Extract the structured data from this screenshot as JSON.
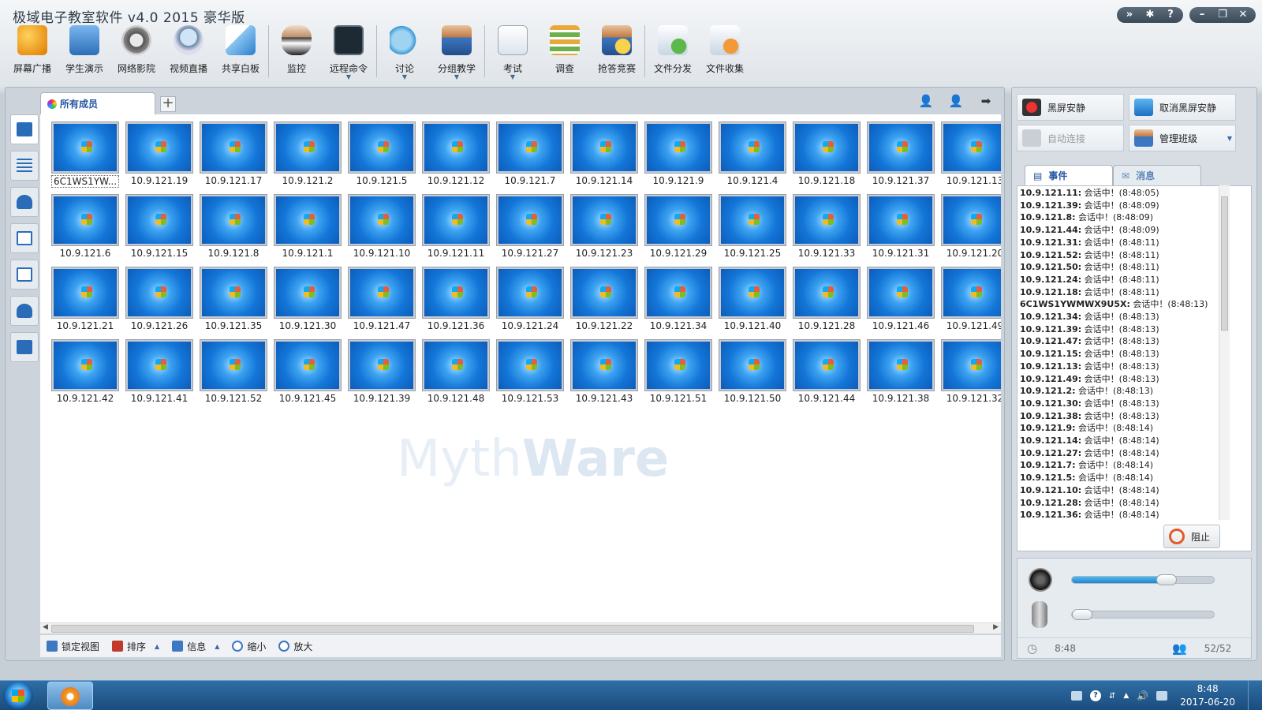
{
  "app": {
    "title": "极域电子教室软件 v4.0 2015 豪华版"
  },
  "window_buttons": [
    "expand-icon",
    "gear-icon",
    "help-icon",
    "minimize-icon",
    "restore-icon",
    "close-icon"
  ],
  "toolbar": [
    {
      "label": "屏幕广播",
      "icon": "broadcast-icon",
      "dropdown": false
    },
    {
      "label": "学生演示",
      "icon": "student-demo-icon",
      "dropdown": false
    },
    {
      "label": "网络影院",
      "icon": "film-reel-icon",
      "dropdown": false
    },
    {
      "label": "视频直播",
      "icon": "webcam-icon",
      "dropdown": false
    },
    {
      "label": "共享白板",
      "icon": "whiteboard-icon",
      "dropdown": false
    },
    {
      "label": "监控",
      "icon": "monitor-person-icon",
      "dropdown": false
    },
    {
      "label": "远程命令",
      "icon": "command-prompt-icon",
      "dropdown": true
    },
    {
      "label": "讨论",
      "icon": "chat-bubbles-icon",
      "dropdown": true
    },
    {
      "label": "分组教学",
      "icon": "group-teaching-icon",
      "dropdown": true
    },
    {
      "label": "考试",
      "icon": "exam-clock-icon",
      "dropdown": true
    },
    {
      "label": "调查",
      "icon": "survey-bars-icon",
      "dropdown": false
    },
    {
      "label": "抢答竞赛",
      "icon": "quiz-star-icon",
      "dropdown": false
    },
    {
      "label": "文件分发",
      "icon": "file-send-icon",
      "dropdown": false
    },
    {
      "label": "文件收集",
      "icon": "file-collect-icon",
      "dropdown": false
    }
  ],
  "tabs": {
    "active": "所有成员",
    "add": "+"
  },
  "watermark": {
    "a": "Myth",
    "b": "Ware"
  },
  "members": [
    {
      "name": "6C1WS1YWMWX9U5X",
      "display": "6C1WS1YW..."
    },
    {
      "name": "10.9.121.19"
    },
    {
      "name": "10.9.121.17"
    },
    {
      "name": "10.9.121.2"
    },
    {
      "name": "10.9.121.5"
    },
    {
      "name": "10.9.121.12"
    },
    {
      "name": "10.9.121.7"
    },
    {
      "name": "10.9.121.14"
    },
    {
      "name": "10.9.121.9"
    },
    {
      "name": "10.9.121.4"
    },
    {
      "name": "10.9.121.18"
    },
    {
      "name": "10.9.121.37"
    },
    {
      "name": "10.9.121.13"
    },
    {
      "name": "10.9.121.6"
    },
    {
      "name": "10.9.121.15"
    },
    {
      "name": "10.9.121.8"
    },
    {
      "name": "10.9.121.1"
    },
    {
      "name": "10.9.121.10"
    },
    {
      "name": "10.9.121.11"
    },
    {
      "name": "10.9.121.27"
    },
    {
      "name": "10.9.121.23"
    },
    {
      "name": "10.9.121.29"
    },
    {
      "name": "10.9.121.25"
    },
    {
      "name": "10.9.121.33"
    },
    {
      "name": "10.9.121.31"
    },
    {
      "name": "10.9.121.20"
    },
    {
      "name": "10.9.121.21"
    },
    {
      "name": "10.9.121.26"
    },
    {
      "name": "10.9.121.35"
    },
    {
      "name": "10.9.121.30"
    },
    {
      "name": "10.9.121.47"
    },
    {
      "name": "10.9.121.36"
    },
    {
      "name": "10.9.121.24"
    },
    {
      "name": "10.9.121.22"
    },
    {
      "name": "10.9.121.34"
    },
    {
      "name": "10.9.121.40"
    },
    {
      "name": "10.9.121.28"
    },
    {
      "name": "10.9.121.46"
    },
    {
      "name": "10.9.121.49"
    },
    {
      "name": "10.9.121.42"
    },
    {
      "name": "10.9.121.41"
    },
    {
      "name": "10.9.121.52"
    },
    {
      "name": "10.9.121.45"
    },
    {
      "name": "10.9.121.39"
    },
    {
      "name": "10.9.121.48"
    },
    {
      "name": "10.9.121.53"
    },
    {
      "name": "10.9.121.43"
    },
    {
      "name": "10.9.121.51"
    },
    {
      "name": "10.9.121.50"
    },
    {
      "name": "10.9.121.44"
    },
    {
      "name": "10.9.121.38"
    },
    {
      "name": "10.9.121.32"
    }
  ],
  "bottom_bar": {
    "lock_view": "锁定视图",
    "sort": "排序",
    "info": "信息",
    "zoom_out": "缩小",
    "zoom_in": "放大"
  },
  "controls": {
    "black_screen": "黑屏安静",
    "cancel_black_screen": "取消黑屏安静",
    "auto_connect": "自动连接",
    "manage_class": "管理班级"
  },
  "event_tabs": {
    "events": "事件",
    "messages": "消息"
  },
  "events": [
    {
      "who": "10.9.121.11:",
      "text": " 会话中！(8:48:05)"
    },
    {
      "who": "10.9.121.39:",
      "text": " 会话中！(8:48:09)"
    },
    {
      "who": "10.9.121.8:",
      "text": " 会话中！(8:48:09)"
    },
    {
      "who": "10.9.121.44:",
      "text": " 会话中！(8:48:09)"
    },
    {
      "who": "10.9.121.31:",
      "text": " 会话中！(8:48:11)"
    },
    {
      "who": "10.9.121.52:",
      "text": " 会话中！(8:48:11)"
    },
    {
      "who": "10.9.121.50:",
      "text": " 会话中！(8:48:11)"
    },
    {
      "who": "10.9.121.24:",
      "text": " 会话中！(8:48:11)"
    },
    {
      "who": "10.9.121.18:",
      "text": " 会话中！(8:48:11)"
    },
    {
      "who": "6C1WS1YWMWX9U5X:",
      "text": " 会话中！(8:48:13)"
    },
    {
      "who": "10.9.121.34:",
      "text": " 会话中！(8:48:13)"
    },
    {
      "who": "10.9.121.39:",
      "text": " 会话中！(8:48:13)"
    },
    {
      "who": "10.9.121.47:",
      "text": " 会话中！(8:48:13)"
    },
    {
      "who": "10.9.121.15:",
      "text": " 会话中！(8:48:13)"
    },
    {
      "who": "10.9.121.13:",
      "text": " 会话中！(8:48:13)"
    },
    {
      "who": "10.9.121.49:",
      "text": " 会话中！(8:48:13)"
    },
    {
      "who": "10.9.121.2:",
      "text": " 会话中！(8:48:13)"
    },
    {
      "who": "10.9.121.30:",
      "text": " 会话中！(8:48:13)"
    },
    {
      "who": "10.9.121.38:",
      "text": " 会话中！(8:48:13)"
    },
    {
      "who": "10.9.121.9:",
      "text": " 会话中！(8:48:14)"
    },
    {
      "who": "10.9.121.14:",
      "text": " 会话中！(8:48:14)"
    },
    {
      "who": "10.9.121.27:",
      "text": " 会话中！(8:48:14)"
    },
    {
      "who": "10.9.121.7:",
      "text": " 会话中！(8:48:14)"
    },
    {
      "who": "10.9.121.5:",
      "text": " 会话中！(8:48:14)"
    },
    {
      "who": "10.9.121.10:",
      "text": " 会话中！(8:48:14)"
    },
    {
      "who": "10.9.121.28:",
      "text": " 会话中！(8:48:14)"
    },
    {
      "who": "10.9.121.36:",
      "text": " 会话中！(8:48:14)"
    }
  ],
  "stop_button": "阻止",
  "audio": {
    "speaker_volume": 0.67,
    "mic_volume": 0.0
  },
  "status": {
    "time": "8:48",
    "online": "52/52"
  },
  "taskbar": {
    "time": "8:48",
    "date": "2017-06-20"
  }
}
